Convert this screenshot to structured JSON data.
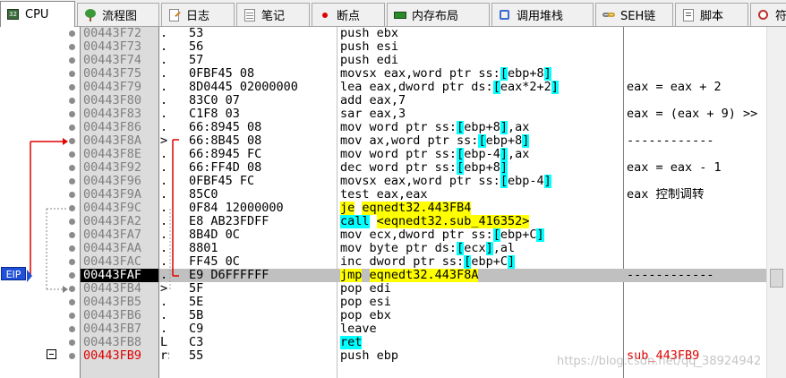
{
  "tabs": [
    {
      "label": "CPU",
      "icon": "cpu-icon",
      "active": true
    },
    {
      "label": "流程图",
      "icon": "graph-icon"
    },
    {
      "label": "日志",
      "icon": "log-icon"
    },
    {
      "label": "笔记",
      "icon": "notes-icon"
    },
    {
      "label": "断点",
      "icon": "breakpoint-icon"
    },
    {
      "label": "内存布局",
      "icon": "memory-map-icon"
    },
    {
      "label": "调用堆栈",
      "icon": "call-stack-icon"
    },
    {
      "label": "SEH链",
      "icon": "seh-chain-icon"
    },
    {
      "label": "脚本",
      "icon": "script-icon"
    },
    {
      "label": "符",
      "icon": "symbols-icon"
    }
  ],
  "eip_label": "EIP",
  "colors": {
    "eip_bg": "#2050d8",
    "jump_highlight": "#ffff00",
    "call_highlight": "#00ffff",
    "arrow": "#e00000"
  },
  "rows": [
    {
      "addr": "00443F72",
      "mark": ".",
      "bytes": "53",
      "instr": "push ebx",
      "comment": ""
    },
    {
      "addr": "00443F73",
      "mark": ".",
      "bytes": "56",
      "instr": "push esi",
      "comment": ""
    },
    {
      "addr": "00443F74",
      "mark": ".",
      "bytes": "57",
      "instr": "push edi",
      "comment": ""
    },
    {
      "addr": "00443F75",
      "mark": ".",
      "bytes": "0FBF45 08",
      "instr": "movsx eax,word ptr ss:[ebp+8]",
      "comment": ""
    },
    {
      "addr": "00443F79",
      "mark": ".",
      "bytes": "8D0445 02000000",
      "instr": "lea eax,dword ptr ds:[eax*2+2]",
      "comment": "eax = eax + 2"
    },
    {
      "addr": "00443F80",
      "mark": ".",
      "bytes": "83C0 07",
      "instr": "add eax,7",
      "comment": ""
    },
    {
      "addr": "00443F83",
      "mark": ".",
      "bytes": "C1F8 03",
      "instr": "sar eax,3",
      "comment": "eax = (eax + 9) >>"
    },
    {
      "addr": "00443F86",
      "mark": ".",
      "bytes": "66:8945 08",
      "instr": "mov word ptr ss:[ebp+8],ax",
      "comment": ""
    },
    {
      "addr": "00443F8A",
      "mark": ">",
      "bytes": "66:8B45 08",
      "instr": "mov ax,word ptr ss:[ebp+8]",
      "comment": "------------"
    },
    {
      "addr": "00443F8E",
      "mark": ".",
      "bytes": "66:8945 FC",
      "instr": "mov word ptr ss:[ebp-4],ax",
      "comment": ""
    },
    {
      "addr": "00443F92",
      "mark": ".",
      "bytes": "66:FF4D 08",
      "instr": "dec word ptr ss:[ebp+8]",
      "comment": "eax = eax - 1"
    },
    {
      "addr": "00443F96",
      "mark": ".",
      "bytes": "0FBF45 FC",
      "instr": "movsx eax,word ptr ss:[ebp-4]",
      "comment": ""
    },
    {
      "addr": "00443F9A",
      "mark": ".",
      "bytes": "85C0",
      "instr": "test eax,eax",
      "comment": "eax 控制调转"
    },
    {
      "addr": "00443F9C",
      "mark": ".",
      "bytes": "0F84 12000000",
      "instr": "je eqnedt32.443FB4",
      "comment": ""
    },
    {
      "addr": "00443FA2",
      "mark": ".",
      "bytes": "E8 AB23FDFF",
      "instr": "call <eqnedt32.sub_416352>",
      "comment": ""
    },
    {
      "addr": "00443FA7",
      "mark": ".",
      "bytes": "8B4D 0C",
      "instr": "mov ecx,dword ptr ss:[ebp+C]",
      "comment": ""
    },
    {
      "addr": "00443FAA",
      "mark": ".",
      "bytes": "8801",
      "instr": "mov byte ptr ds:[ecx],al",
      "comment": ""
    },
    {
      "addr": "00443FAC",
      "mark": ".",
      "bytes": "FF45 0C",
      "instr": "inc dword ptr ss:[ebp+C]",
      "comment": ""
    },
    {
      "addr": "00443FAF",
      "mark": ".",
      "bytes": "E9 D6FFFFFF",
      "instr": "jmp eqnedt32.443F8A",
      "comment": "------------"
    },
    {
      "addr": "00443FB4",
      "mark": ">",
      "bytes": "5F",
      "instr": "pop edi",
      "comment": ""
    },
    {
      "addr": "00443FB5",
      "mark": ".",
      "bytes": "5E",
      "instr": "pop esi",
      "comment": ""
    },
    {
      "addr": "00443FB6",
      "mark": ".",
      "bytes": "5B",
      "instr": "pop ebx",
      "comment": ""
    },
    {
      "addr": "00443FB7",
      "mark": ".",
      "bytes": "C9",
      "instr": "leave",
      "comment": ""
    },
    {
      "addr": "00443FB8",
      "mark": "L.",
      "bytes": "C3",
      "instr": "ret",
      "comment": ""
    },
    {
      "addr": "00443FB9",
      "mark": "r$",
      "bytes": "55",
      "instr": "push ebp",
      "comment": "sub_443FB9"
    }
  ],
  "eip_row_addr": "00443FAF",
  "watermark": "https://blog.csdn.net/qq_38924942"
}
